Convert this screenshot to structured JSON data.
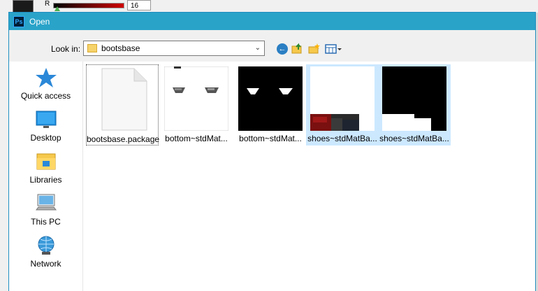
{
  "background": {
    "channel_label": "R",
    "channel_value": "16"
  },
  "dialog": {
    "title": "Open",
    "app_icon_text": "Ps"
  },
  "lookin": {
    "label": "Look in:",
    "current_folder": "bootsbase"
  },
  "places": [
    {
      "label": "Quick access",
      "icon": "star-icon"
    },
    {
      "label": "Desktop",
      "icon": "desktop-icon"
    },
    {
      "label": "Libraries",
      "icon": "libraries-icon"
    },
    {
      "label": "This PC",
      "icon": "computer-icon"
    },
    {
      "label": "Network",
      "icon": "network-icon"
    }
  ],
  "files": [
    {
      "name": "bootsbase.package",
      "type": "generic-file",
      "selected": false,
      "focused": true
    },
    {
      "name": "bottom~stdMat...",
      "type": "image-thumbnail",
      "selected": false
    },
    {
      "name": "bottom~stdMat...",
      "type": "image-thumbnail",
      "selected": false
    },
    {
      "name": "shoes~stdMatBa...",
      "type": "image-thumbnail",
      "selected": true
    },
    {
      "name": "shoes~stdMatBa...",
      "type": "image-thumbnail",
      "selected": true
    }
  ],
  "colors": {
    "titlebar": "#2aa3c9",
    "selection": "#cce8ff",
    "border": "#1f8ec0"
  }
}
